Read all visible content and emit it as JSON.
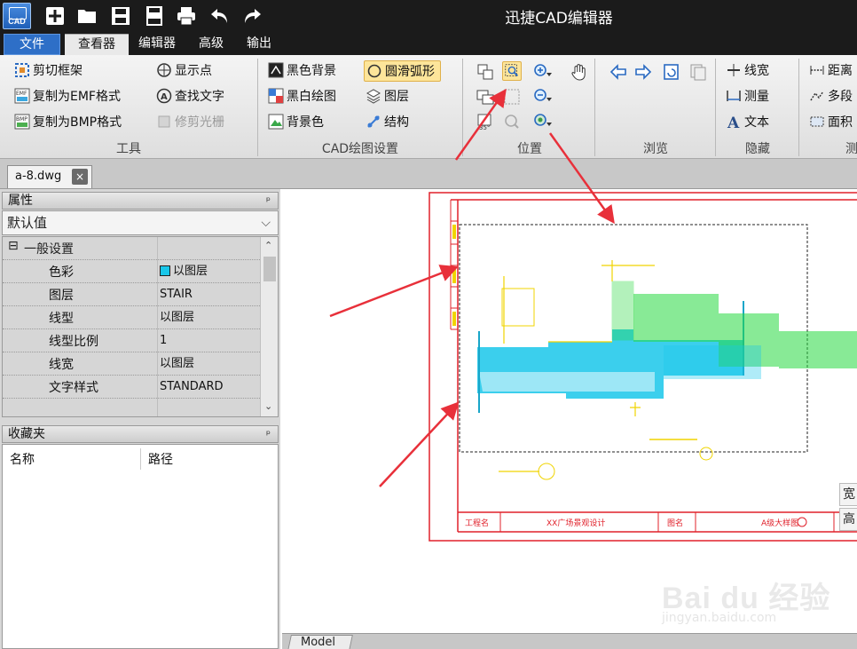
{
  "window": {
    "title": "迅捷CAD编辑器",
    "logo_text": "CAD"
  },
  "menu": {
    "tabs": [
      "文件",
      "查看器",
      "编辑器",
      "高级",
      "输出"
    ],
    "active": "查看器"
  },
  "ribbon": {
    "tools": {
      "label": "工具",
      "items": [
        "剪切框架",
        "复制为EMF格式",
        "复制为BMP格式",
        "显示点",
        "查找文字",
        "修剪光栅"
      ]
    },
    "cad_settings": {
      "label": "CAD绘图设置",
      "items": [
        "黑色背景",
        "黑白绘图",
        "背景色",
        "圆滑弧形",
        "图层",
        "结构"
      ]
    },
    "position": {
      "label": "位置"
    },
    "browse": {
      "label": "浏览"
    },
    "hide": {
      "label": "隐藏",
      "items": [
        "线宽",
        "测量",
        "文本"
      ]
    },
    "measure": {
      "label": "测",
      "items": [
        "距离",
        "多段",
        "面积"
      ]
    }
  },
  "document_tab": {
    "name": "a-8.dwg",
    "close": "×"
  },
  "properties": {
    "header": "属性",
    "pin": "ᵖ",
    "dropdown_value": "默认值",
    "section": "一般设置",
    "section_toggle": "⊟",
    "rows": [
      {
        "name": "色彩",
        "value": "以图层",
        "swatch": "#19c7ea"
      },
      {
        "name": "图层",
        "value": "STAIR"
      },
      {
        "name": "线型",
        "value": "以图层"
      },
      {
        "name": "线型比例",
        "value": "1"
      },
      {
        "name": "线宽",
        "value": "以图层"
      },
      {
        "name": "文字样式",
        "value": "STANDARD"
      }
    ]
  },
  "favorites": {
    "header": "收藏夹",
    "columns": [
      "名称",
      "路径"
    ]
  },
  "drawing": {
    "title_block": [
      "工程名",
      "XX广场景观设计",
      "图名",
      "A级大样图"
    ]
  },
  "status": {
    "model_tab": "Model"
  },
  "side_chips": [
    "宽",
    "高"
  ],
  "watermark": {
    "text": "Bai du 经验",
    "url": "jingyan.baidu.com"
  },
  "colors": {
    "accent": "#2e6fc7",
    "highlight": "#fde59a",
    "annotation_arrow": "#e8303a",
    "cad_cyan": "#19c7ea",
    "cad_green": "#27d93f",
    "cad_yellow": "#f0d400",
    "border_red": "#e0202a"
  }
}
